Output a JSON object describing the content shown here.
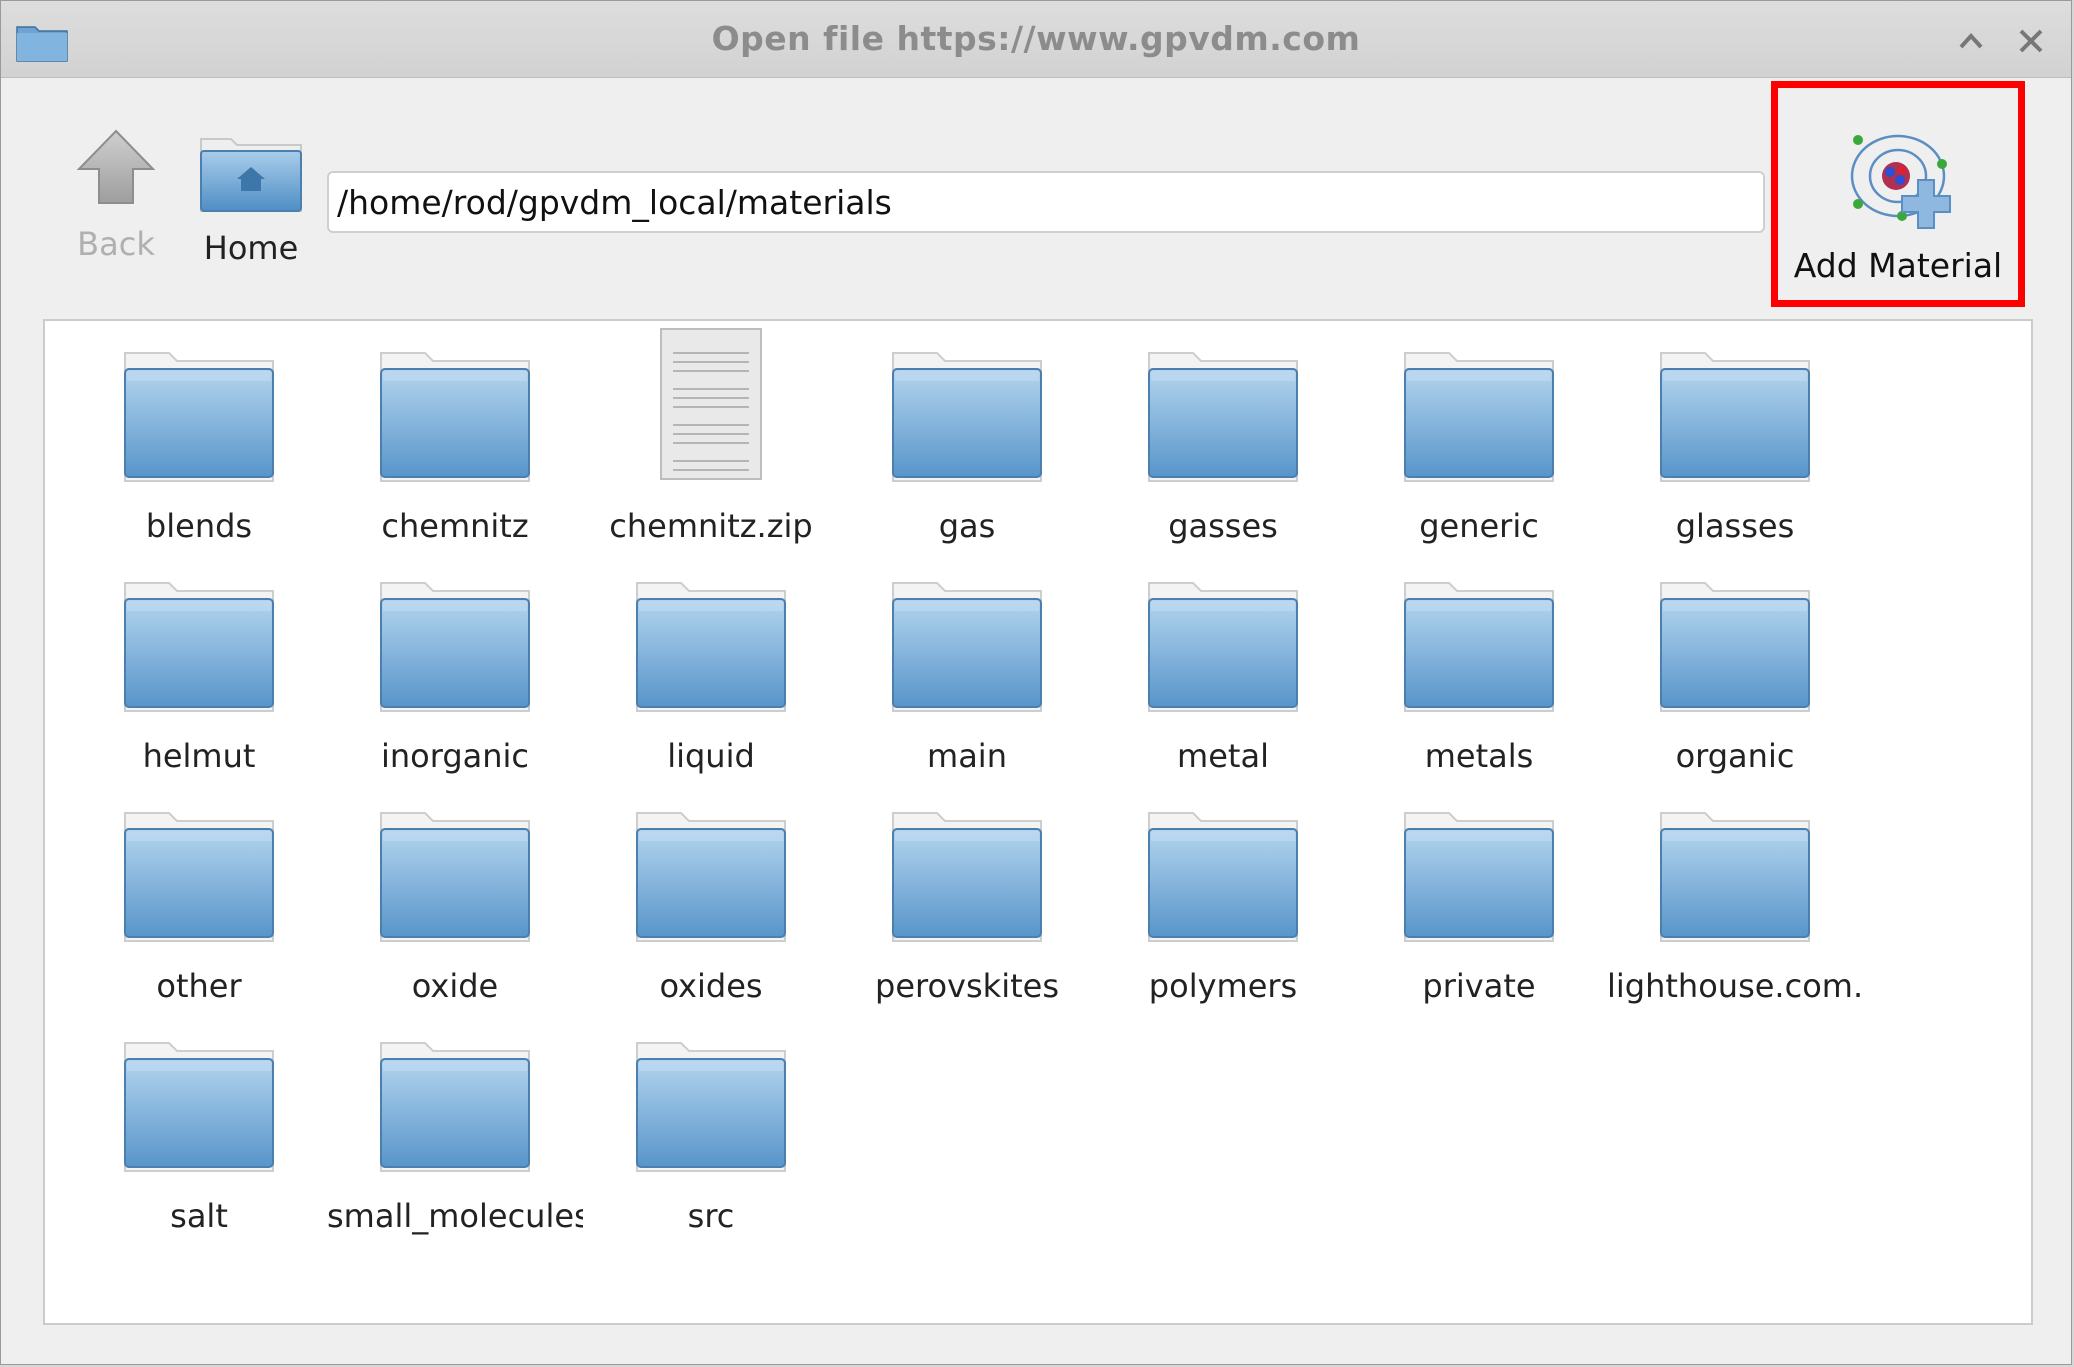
{
  "window": {
    "title": "Open file https://www.gpvdm.com"
  },
  "toolbar": {
    "back_label": "Back",
    "home_label": "Home",
    "path_value": "/home/rod/gpvdm_local/materials",
    "add_material_label": "Add Material"
  },
  "files": [
    {
      "name": "blends",
      "type": "folder"
    },
    {
      "name": "chemnitz",
      "type": "folder"
    },
    {
      "name": "chemnitz.zip",
      "type": "file"
    },
    {
      "name": "gas",
      "type": "folder"
    },
    {
      "name": "gasses",
      "type": "folder"
    },
    {
      "name": "generic",
      "type": "folder"
    },
    {
      "name": "glasses",
      "type": "folder"
    },
    {
      "name": "helmut",
      "type": "folder"
    },
    {
      "name": "inorganic",
      "type": "folder"
    },
    {
      "name": "liquid",
      "type": "folder"
    },
    {
      "name": "main",
      "type": "folder"
    },
    {
      "name": "metal",
      "type": "folder"
    },
    {
      "name": "metals",
      "type": "folder"
    },
    {
      "name": "organic",
      "type": "folder"
    },
    {
      "name": "other",
      "type": "folder"
    },
    {
      "name": "oxide",
      "type": "folder"
    },
    {
      "name": "oxides",
      "type": "folder"
    },
    {
      "name": "perovskites",
      "type": "folder"
    },
    {
      "name": "polymers",
      "type": "folder"
    },
    {
      "name": "private",
      "type": "folder"
    },
    {
      "name": "lighthouse.com.",
      "type": "folder"
    },
    {
      "name": "salt",
      "type": "folder"
    },
    {
      "name": "small_molecules",
      "type": "folder"
    },
    {
      "name": "src",
      "type": "folder"
    }
  ]
}
